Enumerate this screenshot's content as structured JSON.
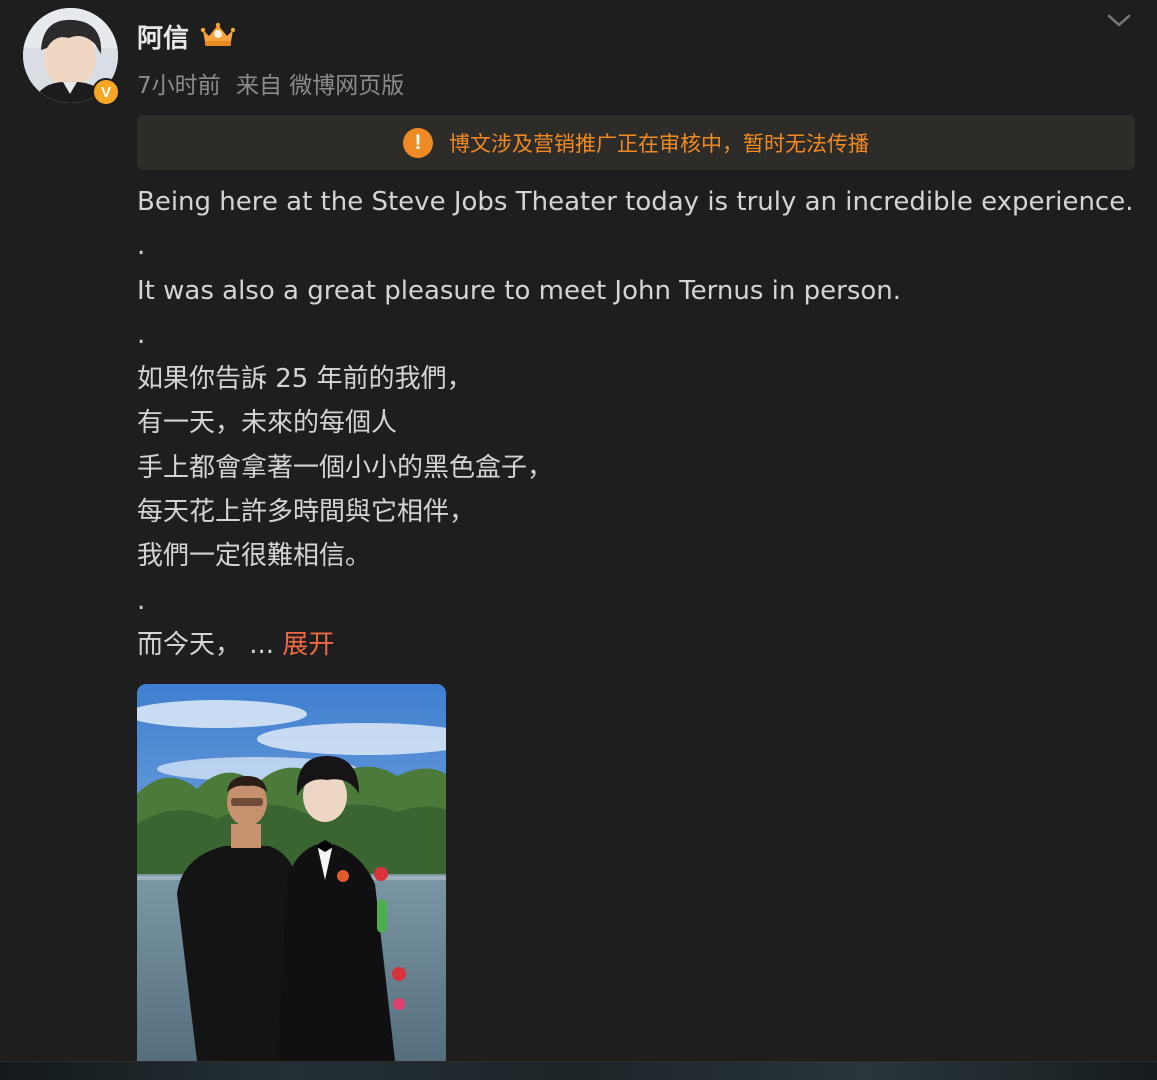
{
  "user": {
    "name": "阿信",
    "verified_badge": "V",
    "crown_icon": "crown-badge-icon"
  },
  "meta": {
    "time": "7小时前",
    "source": "来自 微博网页版"
  },
  "notice": {
    "icon": "!",
    "text": "博文涉及营销推广正在审核中，暂时无法传播"
  },
  "content": {
    "lines": [
      "Being here at the Steve Jobs Theater today is truly an incredible experience.",
      ".",
      "It was also a great pleasure to meet John Ternus in person.",
      ".",
      "如果你告訴 25 年前的我們，",
      "有一天，未來的每個人",
      "手上都會拿著一個小小的黑色盒子，",
      "每天花上許多時間與它相伴，",
      "我們一定很難相信。",
      ".",
      "而今天，  ..."
    ],
    "expand_label": "展开"
  },
  "colors": {
    "background": "#1e1e1e",
    "accent_orange": "#f08a24",
    "expand_link": "#f06844",
    "meta_gray": "#8c8c8c"
  }
}
